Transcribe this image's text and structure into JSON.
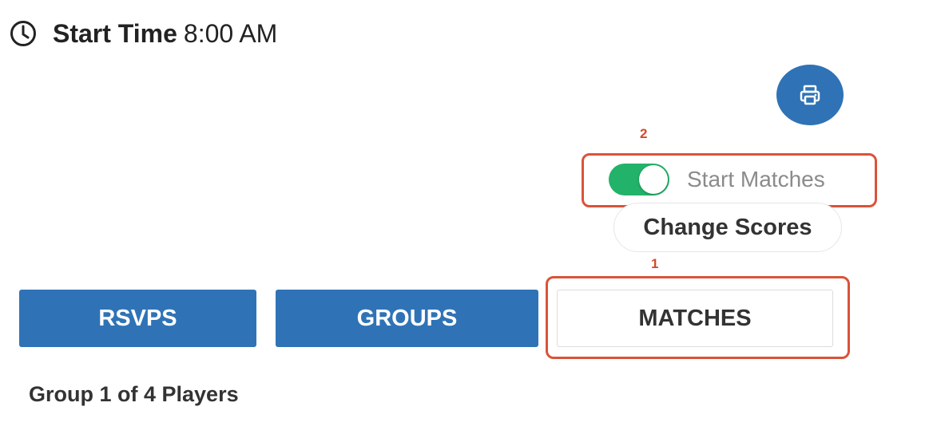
{
  "header": {
    "start_time_label": "Start Time",
    "start_time_value": "8:00 AM"
  },
  "annotations": {
    "marker_1": "1",
    "marker_2": "2"
  },
  "toggle": {
    "label": "Start Matches",
    "state": "on",
    "color": "#23b26a"
  },
  "actions": {
    "change_scores_label": "Change Scores"
  },
  "tabs": [
    {
      "label": "RSVPS",
      "active": false
    },
    {
      "label": "GROUPS",
      "active": false
    },
    {
      "label": "MATCHES",
      "active": true
    }
  ],
  "content": {
    "group_heading": "Group 1 of 4 Players"
  },
  "colors": {
    "primary": "#2f73b6",
    "highlight": "#d9533a",
    "toggle_on": "#23b26a"
  },
  "icons": {
    "clock": "clock-icon",
    "print": "printer-icon"
  }
}
